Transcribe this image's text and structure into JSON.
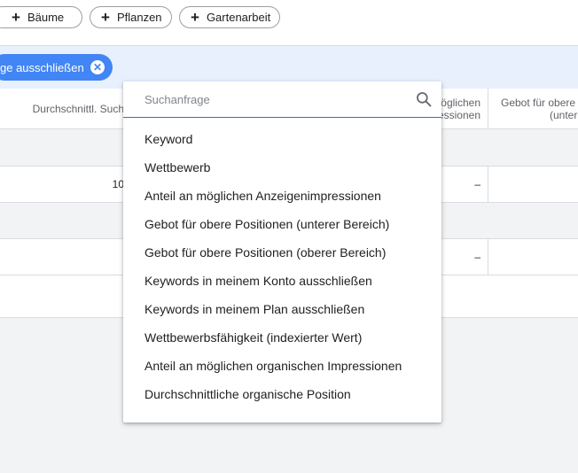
{
  "chips": [
    {
      "label": "Bäume"
    },
    {
      "label": "Pflanzen"
    },
    {
      "label": "Gartenarbeit"
    }
  ],
  "filter": {
    "label": "ge ausschließen",
    "remove_icon": "close-circle-icon"
  },
  "table": {
    "headers": {
      "avg_search": "Durchschnittl. Such",
      "share_line1": "öglichen",
      "share_line2": "essionen",
      "bid_line1": "Gebot für obere",
      "bid_line2": "(untere"
    },
    "rows": [
      {
        "avg": "10",
        "share": "–"
      },
      {
        "avg": "",
        "share": "–"
      }
    ]
  },
  "dropdown": {
    "search_placeholder": "Suchanfrage",
    "search_value": "",
    "options": [
      "Keyword",
      "Wettbewerb",
      "Anteil an möglichen Anzeigenimpressionen",
      "Gebot für obere Positionen (unterer Bereich)",
      "Gebot für obere Positionen (oberer Bereich)",
      "Keywords in meinem Konto ausschließen",
      "Keywords in meinem Plan ausschließen",
      "Wettbewerbsfähigkeit (indexierter Wert)",
      "Anteil an möglichen organischen Impressionen",
      "Durchschnittliche organische Position"
    ]
  },
  "colors": {
    "accent": "#1a73e8",
    "chip_filter": "#4285f4",
    "filter_bar": "#e8f0fe"
  }
}
